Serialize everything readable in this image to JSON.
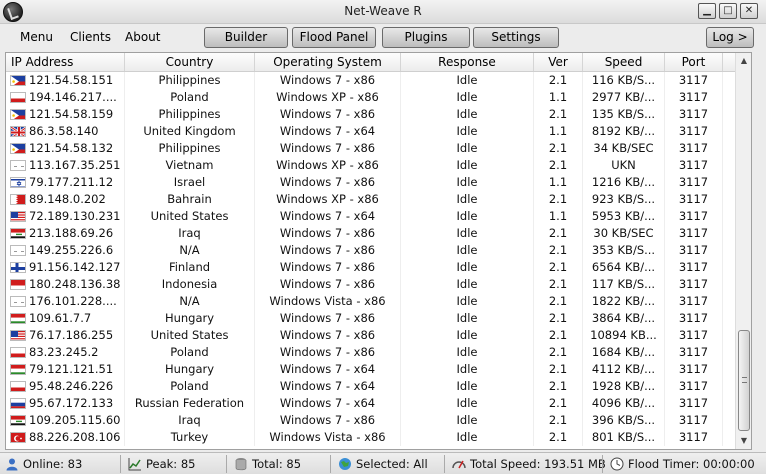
{
  "window": {
    "title": "Net-Weave R",
    "minimize": "▁",
    "maximize": "□",
    "close": "✕"
  },
  "menu": {
    "items": [
      "Menu",
      "Clients",
      "About"
    ]
  },
  "toolbar": {
    "buttons": [
      "Builder",
      "Flood Panel",
      "Plugins",
      "Settings"
    ],
    "log": "Log >"
  },
  "table": {
    "columns": [
      "IP Address",
      "Country",
      "Operating System",
      "Response",
      "Ver",
      "Speed",
      "Port"
    ],
    "rows": [
      {
        "ip": "121.54.58.151",
        "flag": "ph",
        "country": "Philippines",
        "os": "Windows 7 - x86",
        "response": "Idle",
        "ver": "2.1",
        "speed": "116 KB/S...",
        "port": "3117"
      },
      {
        "ip": "194.146.217....",
        "flag": "pl",
        "country": "Poland",
        "os": "Windows XP - x86",
        "response": "Idle",
        "ver": "1.1",
        "speed": "2977 KB/...",
        "port": "3117"
      },
      {
        "ip": "121.54.58.159",
        "flag": "ph",
        "country": "Philippines",
        "os": "Windows 7 - x86",
        "response": "Idle",
        "ver": "2.1",
        "speed": "135 KB/S...",
        "port": "3117"
      },
      {
        "ip": "86.3.58.140",
        "flag": "gb",
        "country": "United Kingdom",
        "os": "Windows 7 - x64",
        "response": "Idle",
        "ver": "1.1",
        "speed": "8192 KB/...",
        "port": "3117"
      },
      {
        "ip": "121.54.58.132",
        "flag": "ph",
        "country": "Philippines",
        "os": "Windows 7 - x86",
        "response": "Idle",
        "ver": "2.1",
        "speed": "34 KB/SEC",
        "port": "3117"
      },
      {
        "ip": "113.167.35.251",
        "flag": "na",
        "country": "Vietnam",
        "os": "Windows XP - x86",
        "response": "Idle",
        "ver": "2.1",
        "speed": "UKN",
        "port": "3117"
      },
      {
        "ip": "79.177.211.12",
        "flag": "il",
        "country": "Israel",
        "os": "Windows 7 - x86",
        "response": "Idle",
        "ver": "1.1",
        "speed": "1216 KB/...",
        "port": "3117"
      },
      {
        "ip": "89.148.0.202",
        "flag": "bh",
        "country": "Bahrain",
        "os": "Windows XP - x86",
        "response": "Idle",
        "ver": "2.1",
        "speed": "923 KB/S...",
        "port": "3117"
      },
      {
        "ip": "72.189.130.231",
        "flag": "us",
        "country": "United States",
        "os": "Windows 7 - x64",
        "response": "Idle",
        "ver": "1.1",
        "speed": "5953 KB/...",
        "port": "3117"
      },
      {
        "ip": "213.188.69.26",
        "flag": "iq",
        "country": "Iraq",
        "os": "Windows 7 - x86",
        "response": "Idle",
        "ver": "2.1",
        "speed": "30 KB/SEC",
        "port": "3117"
      },
      {
        "ip": "149.255.226.6",
        "flag": "na",
        "country": "N/A",
        "os": "Windows 7 - x86",
        "response": "Idle",
        "ver": "2.1",
        "speed": "353 KB/S...",
        "port": "3117"
      },
      {
        "ip": "91.156.142.127",
        "flag": "fi",
        "country": "Finland",
        "os": "Windows 7 - x86",
        "response": "Idle",
        "ver": "2.1",
        "speed": "6564 KB/...",
        "port": "3117"
      },
      {
        "ip": "180.248.136.38",
        "flag": "id",
        "country": "Indonesia",
        "os": "Windows 7 - x86",
        "response": "Idle",
        "ver": "2.1",
        "speed": "117 KB/S...",
        "port": "3117"
      },
      {
        "ip": "176.101.228....",
        "flag": "na",
        "country": "N/A",
        "os": "Windows Vista - x86",
        "response": "Idle",
        "ver": "2.1",
        "speed": "1822 KB/...",
        "port": "3117"
      },
      {
        "ip": "109.61.7.7",
        "flag": "hu",
        "country": "Hungary",
        "os": "Windows 7 - x86",
        "response": "Idle",
        "ver": "2.1",
        "speed": "3864 KB/...",
        "port": "3117"
      },
      {
        "ip": "76.17.186.255",
        "flag": "us",
        "country": "United States",
        "os": "Windows 7 - x86",
        "response": "Idle",
        "ver": "2.1",
        "speed": "10894 KB...",
        "port": "3117"
      },
      {
        "ip": "83.23.245.2",
        "flag": "pl",
        "country": "Poland",
        "os": "Windows 7 - x86",
        "response": "Idle",
        "ver": "2.1",
        "speed": "1684 KB/...",
        "port": "3117"
      },
      {
        "ip": "79.121.121.51",
        "flag": "hu",
        "country": "Hungary",
        "os": "Windows 7 - x64",
        "response": "Idle",
        "ver": "2.1",
        "speed": "4112 KB/...",
        "port": "3117"
      },
      {
        "ip": "95.48.246.226",
        "flag": "pl",
        "country": "Poland",
        "os": "Windows 7 - x64",
        "response": "Idle",
        "ver": "2.1",
        "speed": "1928 KB/...",
        "port": "3117"
      },
      {
        "ip": "95.67.172.133",
        "flag": "ru",
        "country": "Russian Federation",
        "os": "Windows 7 - x64",
        "response": "Idle",
        "ver": "2.1",
        "speed": "4096 KB/...",
        "port": "3117"
      },
      {
        "ip": "109.205.115.60",
        "flag": "iq",
        "country": "Iraq",
        "os": "Windows 7 - x86",
        "response": "Idle",
        "ver": "2.1",
        "speed": "396 KB/S...",
        "port": "3117"
      },
      {
        "ip": "88.226.208.106",
        "flag": "tr",
        "country": "Turkey",
        "os": "Windows Vista - x86",
        "response": "Idle",
        "ver": "2.1",
        "speed": "801 KB/S...",
        "port": "3117"
      }
    ]
  },
  "status": {
    "online": "Online: 83",
    "peak": "Peak: 85",
    "total": "Total: 85",
    "selected": "Selected: All",
    "speed": "Total Speed: 193.51 MB",
    "flood": "Flood Timer: 00:00:00"
  },
  "icons": {
    "user": "user-icon",
    "peak": "chart-icon",
    "total": "database-icon",
    "selected": "network-icon",
    "speed": "speedometer-icon",
    "flood": "clock-icon"
  },
  "colors": {
    "accent": "#2a6bd0",
    "flag_red": "#d01c1c",
    "flag_blue": "#1c3fa0"
  }
}
